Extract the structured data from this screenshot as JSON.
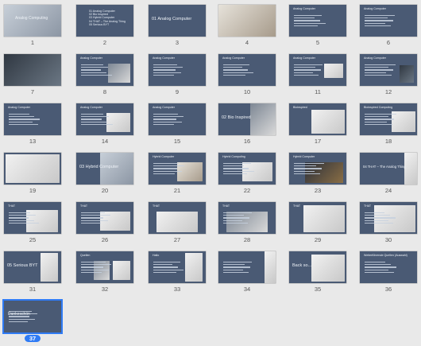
{
  "slides": [
    {
      "num": "1",
      "title": "Analog Computing",
      "subtitle": "",
      "big": "",
      "list": []
    },
    {
      "num": "2",
      "title": "",
      "subtitle": "",
      "big": "",
      "list": [
        "01 Analog Computer",
        "02 Bio Inspired",
        "03 Hybrid Computer",
        "04 THAT – The Analog Thing",
        "05 Serious BYT"
      ]
    },
    {
      "num": "3",
      "title": "",
      "subtitle": "",
      "big": "01 Analog Computer",
      "list": []
    },
    {
      "num": "4",
      "title": "",
      "subtitle": "",
      "big": "",
      "list": []
    },
    {
      "num": "5",
      "title": "Analog Computer",
      "subtitle": "",
      "big": "",
      "list": []
    },
    {
      "num": "6",
      "title": "Analog Computer",
      "subtitle": "",
      "big": "",
      "list": []
    },
    {
      "num": "7",
      "title": "",
      "subtitle": "",
      "big": "",
      "list": []
    },
    {
      "num": "8",
      "title": "Analog Computer",
      "subtitle": "",
      "big": "",
      "list": []
    },
    {
      "num": "9",
      "title": "Analog Computer",
      "subtitle": "",
      "big": "",
      "list": []
    },
    {
      "num": "10",
      "title": "Analog Computer",
      "subtitle": "",
      "big": "",
      "list": []
    },
    {
      "num": "11",
      "title": "Analog Computer",
      "subtitle": "",
      "big": "",
      "list": []
    },
    {
      "num": "12",
      "title": "Analog Computer",
      "subtitle": "",
      "big": "",
      "list": []
    },
    {
      "num": "13",
      "title": "Analog Computer",
      "subtitle": "",
      "big": "",
      "list": []
    },
    {
      "num": "14",
      "title": "Analog Computer",
      "subtitle": "",
      "big": "",
      "list": []
    },
    {
      "num": "15",
      "title": "Analog Computer",
      "subtitle": "",
      "big": "",
      "list": []
    },
    {
      "num": "16",
      "title": "",
      "subtitle": "",
      "big": "02 Bio Inspired",
      "list": []
    },
    {
      "num": "17",
      "title": "Bioinspired",
      "subtitle": "",
      "big": "",
      "list": []
    },
    {
      "num": "18",
      "title": "Bioinspired Computing",
      "subtitle": "",
      "big": "",
      "list": []
    },
    {
      "num": "19",
      "title": "",
      "subtitle": "",
      "big": "",
      "list": []
    },
    {
      "num": "20",
      "title": "",
      "subtitle": "",
      "big": "03 Hybrid Computer",
      "list": []
    },
    {
      "num": "21",
      "title": "Hybrid Computer",
      "subtitle": "",
      "big": "",
      "list": []
    },
    {
      "num": "22",
      "title": "Hybrid Computing",
      "subtitle": "",
      "big": "",
      "list": []
    },
    {
      "num": "23",
      "title": "Hybrid Computer",
      "subtitle": "",
      "big": "",
      "list": []
    },
    {
      "num": "24",
      "title": "",
      "subtitle": "",
      "big": "04 THAT – The Analog Thing",
      "list": []
    },
    {
      "num": "25",
      "title": "THAT",
      "subtitle": "",
      "big": "",
      "list": []
    },
    {
      "num": "26",
      "title": "THAT",
      "subtitle": "",
      "big": "",
      "list": []
    },
    {
      "num": "27",
      "title": "THAT",
      "subtitle": "",
      "big": "",
      "list": []
    },
    {
      "num": "28",
      "title": "THAT",
      "subtitle": "",
      "big": "",
      "list": []
    },
    {
      "num": "29",
      "title": "THAT",
      "subtitle": "",
      "big": "",
      "list": []
    },
    {
      "num": "30",
      "title": "THAT",
      "subtitle": "",
      "big": "",
      "list": []
    },
    {
      "num": "31",
      "title": "",
      "subtitle": "",
      "big": "05 Serious BYT",
      "list": []
    },
    {
      "num": "32",
      "title": "Quellen",
      "subtitle": "",
      "big": "",
      "list": []
    },
    {
      "num": "33",
      "title": "Hallo",
      "subtitle": "",
      "big": "",
      "list": []
    },
    {
      "num": "34",
      "title": "",
      "subtitle": "",
      "big": "",
      "list": []
    },
    {
      "num": "35",
      "title": "",
      "subtitle": "",
      "big": "Back so...",
      "list": []
    },
    {
      "num": "36",
      "title": "Weiterführende Quellen (Auswahl)",
      "subtitle": "",
      "big": "",
      "list": []
    },
    {
      "num": "37",
      "title": "Dankeschön",
      "subtitle": "",
      "big": "",
      "list": []
    }
  ],
  "selected": "37",
  "colors": {
    "slide_bg": "#4a5a74",
    "selection": "#2f7bf5"
  }
}
